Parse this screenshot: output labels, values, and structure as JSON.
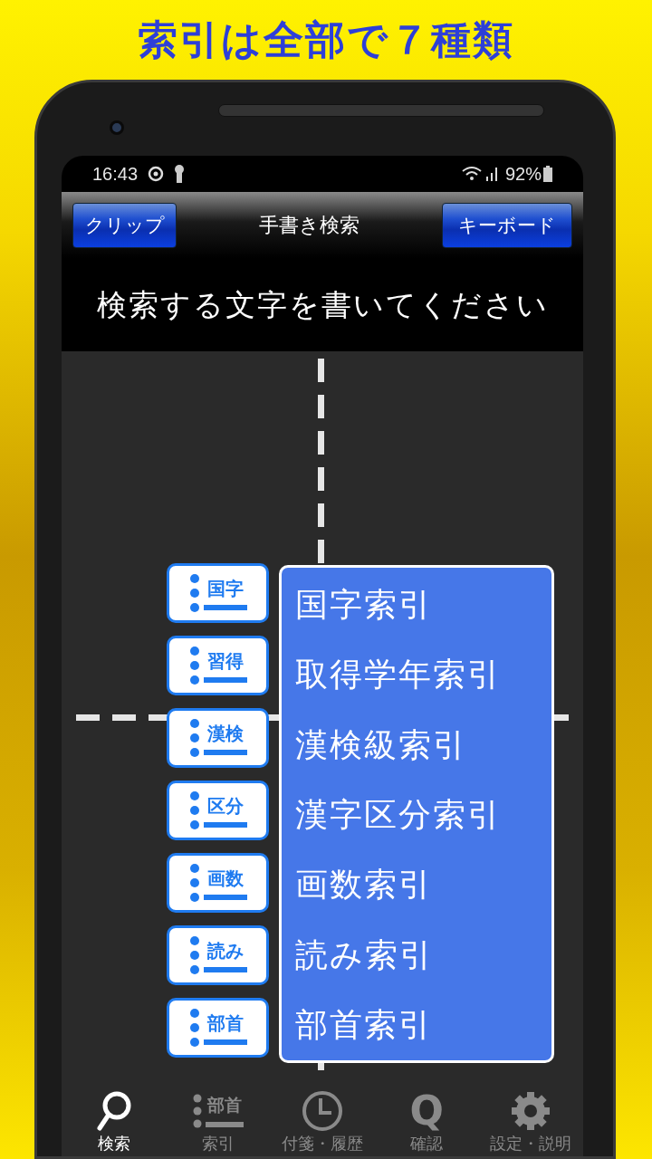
{
  "headline": "索引は全部で７種類",
  "status_bar": {
    "time": "16:43",
    "battery": "92%"
  },
  "toolbar": {
    "left_button": "クリップ",
    "title": "手書き検索",
    "right_button": "キーボード"
  },
  "prompt": "検索する文字を書いてください",
  "index_menu": [
    {
      "chip": "国字",
      "label": "国字索引"
    },
    {
      "chip": "習得",
      "label": "取得学年索引"
    },
    {
      "chip": "漢検",
      "label": "漢検級索引"
    },
    {
      "chip": "区分",
      "label": "漢字区分索引"
    },
    {
      "chip": "画数",
      "label": "画数索引"
    },
    {
      "chip": "読み",
      "label": "読み索引"
    },
    {
      "chip": "部首",
      "label": "部首索引"
    }
  ],
  "tab_bar": [
    {
      "kind": "search",
      "label": "検索",
      "selected": true
    },
    {
      "kind": "index",
      "icon_text": "部首",
      "label": "索引",
      "selected": false
    },
    {
      "kind": "clock",
      "label": "付箋・履歴",
      "selected": false
    },
    {
      "kind": "letter",
      "icon_text": "Q",
      "label": "確認",
      "selected": false
    },
    {
      "kind": "gear",
      "label": "設定・説明",
      "selected": false
    }
  ]
}
